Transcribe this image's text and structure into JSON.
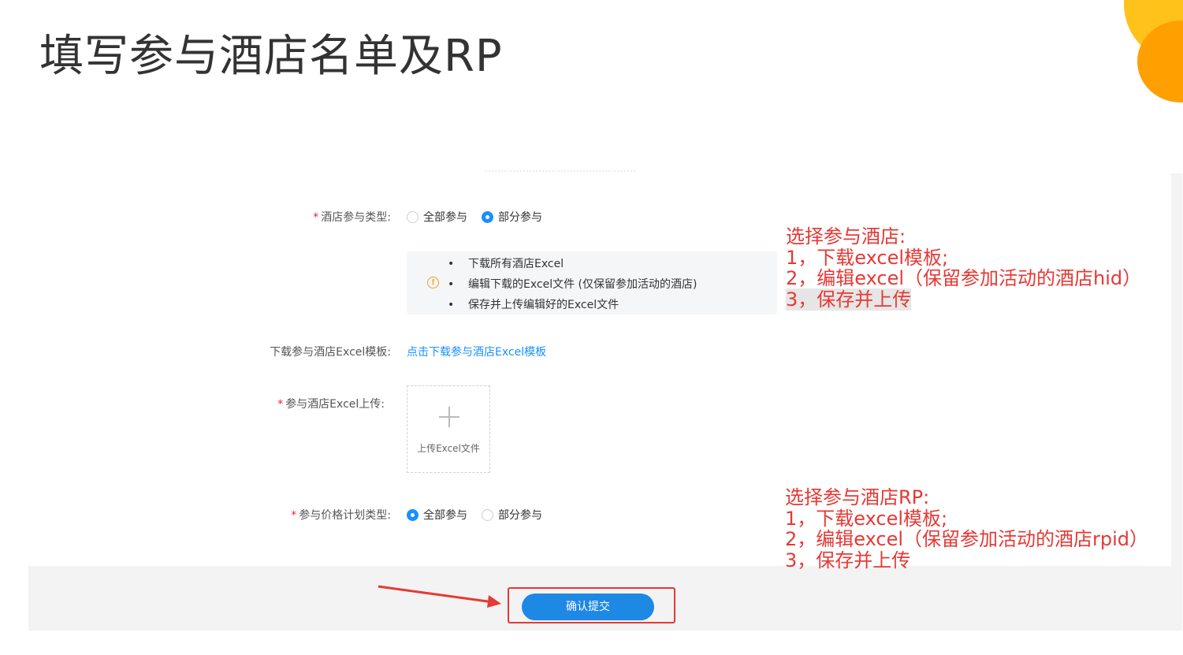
{
  "slide": {
    "title": "填写参与酒店名单及RP"
  },
  "form": {
    "hotel_type": {
      "label": "酒店参与类型:",
      "options": [
        "全部参与",
        "部分参与"
      ],
      "selected_index": 1
    },
    "tips": {
      "icon": "info-icon",
      "lines": [
        "下载所有酒店Excel",
        "编辑下载的Excel文件 (仅保留参加活动的酒店)",
        "保存并上传编辑好的Excel文件"
      ]
    },
    "template": {
      "label": "下载参与酒店Excel模板:",
      "link": "点击下载参与酒店Excel模板"
    },
    "upload": {
      "label": "参与酒店Excel上传:",
      "icon": "plus-icon",
      "button": "上传Excel文件"
    },
    "rp_type": {
      "label": "参与价格计划类型:",
      "options": [
        "全部参与",
        "部分参与"
      ],
      "selected_index": 0
    },
    "submit": "确认提交"
  },
  "annotations": {
    "hotel_steps": [
      "选择参与酒店:",
      "1，下载excel模板;",
      "2，编辑excel（保留参加活动的酒店hid）",
      "3，保存并上传"
    ],
    "rp_steps": [
      "选择参与酒店RP:",
      "1，下载excel模板;",
      "2，编辑excel（保留参加活动的酒店rpid）",
      "3，保存并上传"
    ]
  },
  "colors": {
    "accent": "#1890ff",
    "annotation": "#e53935",
    "required": "#f5222d",
    "deco_yellow": "#ffc21a",
    "deco_orange": "#ff9f00"
  }
}
